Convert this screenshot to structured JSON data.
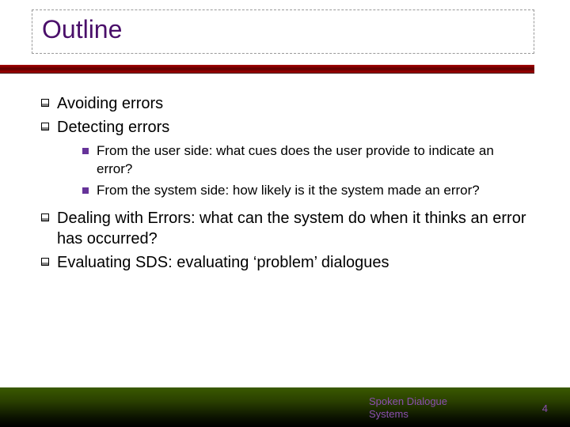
{
  "title": "Outline",
  "bullets": [
    {
      "text": "Avoiding errors",
      "sub": []
    },
    {
      "text": "Detecting errors",
      "sub": [
        "From the user side:  what cues does the user provide to indicate an error?",
        "From the system side:  how likely is it the system made an error?"
      ]
    },
    {
      "text": "Dealing with Errors:  what can the system do when it thinks an error has occurred?",
      "sub": []
    },
    {
      "text": "Evaluating SDS:  evaluating ‘problem’ dialogues",
      "sub": []
    }
  ],
  "footer": {
    "label_line1": "Spoken Dialogue",
    "label_line2": "Systems",
    "page": "4"
  }
}
